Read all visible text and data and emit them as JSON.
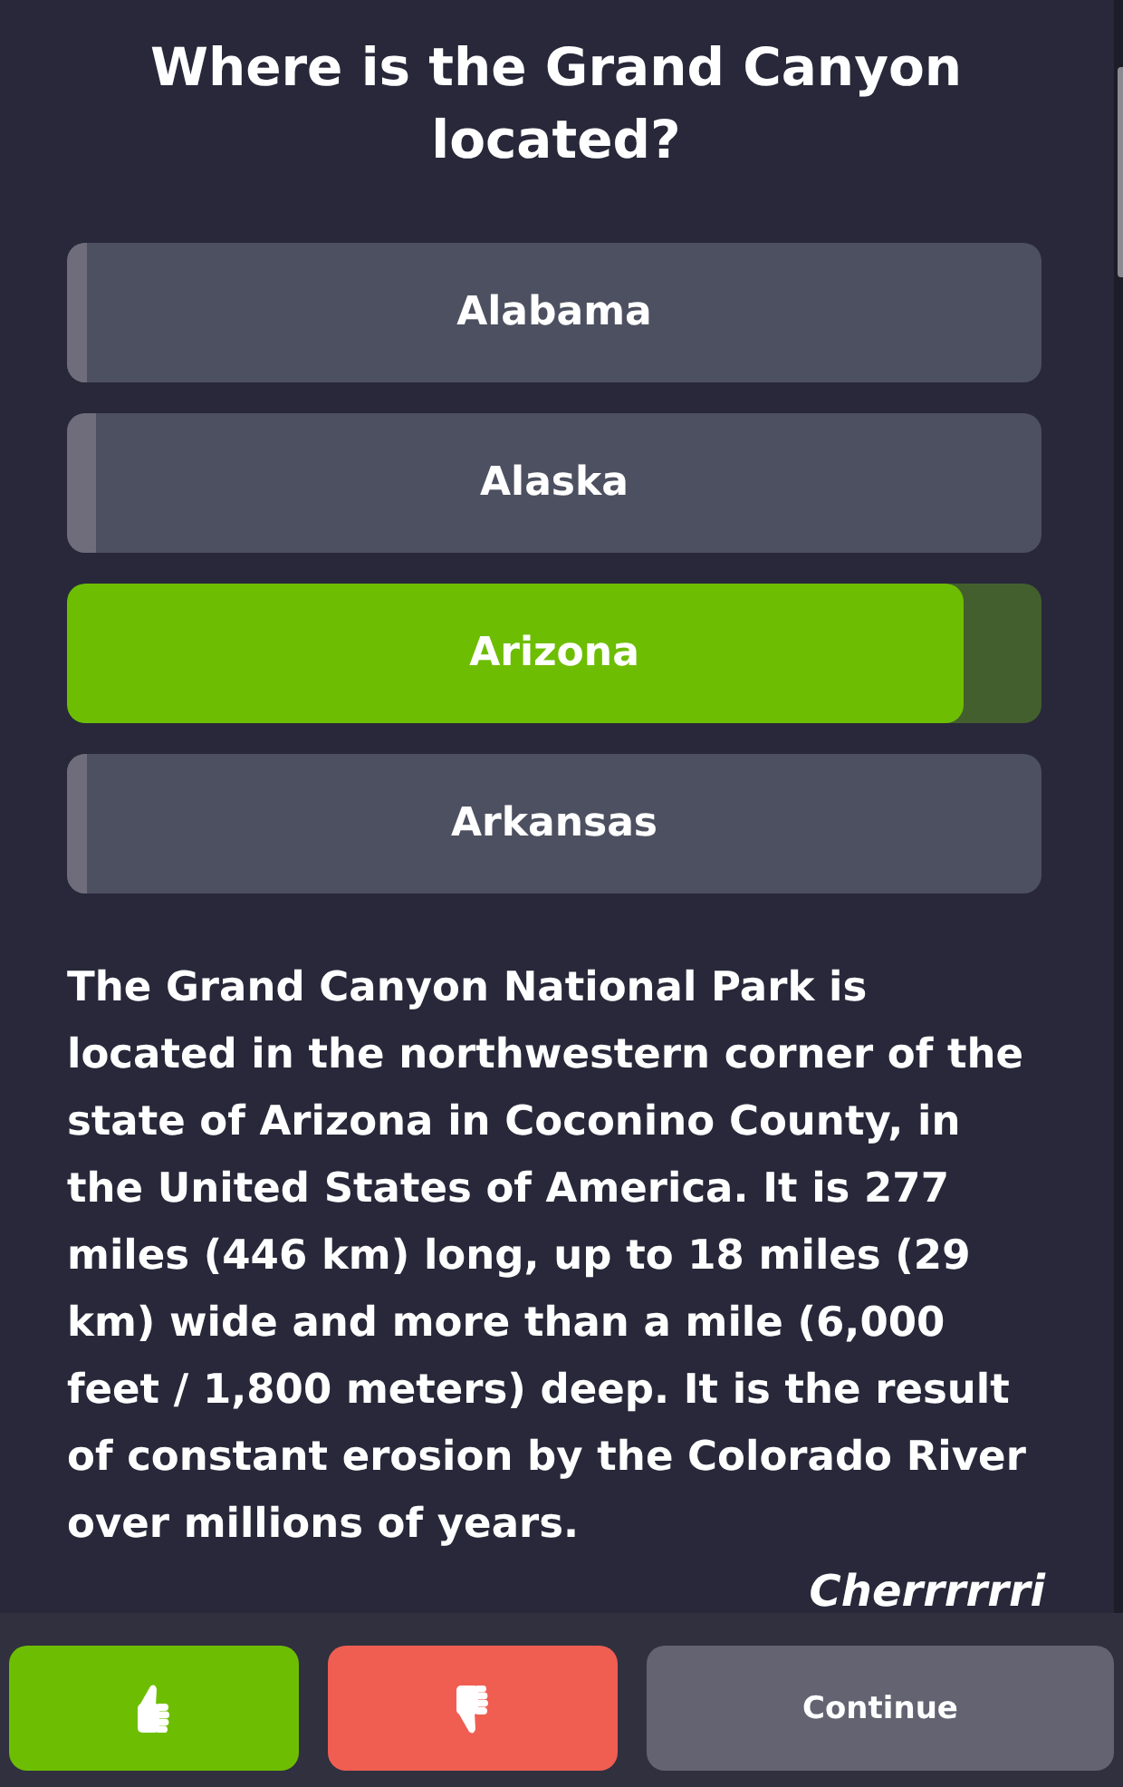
{
  "question": "Where is the Grand Canyon located?",
  "options": [
    {
      "label": "Alabama",
      "correct": false,
      "level": 0.02
    },
    {
      "label": "Alaska",
      "correct": false,
      "level": 0.03
    },
    {
      "label": "Arizona",
      "correct": true,
      "level": 0.92
    },
    {
      "label": "Arkansas",
      "correct": false,
      "level": 0.02
    }
  ],
  "explanation": "The Grand Canyon National Park is located in the northwestern corner of the state of Arizona in Coconino County, in the United States of America. It is 277 miles (446 km) long, up to 18 miles (29 km) wide and more than a mile (6,000 feet / 1,800 meters) deep. It is the result of constant erosion by the Colorado River over millions of years.",
  "author": "Cherrrrrri",
  "footer": {
    "buttons": [
      {
        "kind": "like"
      },
      {
        "kind": "dislike"
      },
      {
        "kind": "continue",
        "label": "Continue"
      }
    ]
  }
}
